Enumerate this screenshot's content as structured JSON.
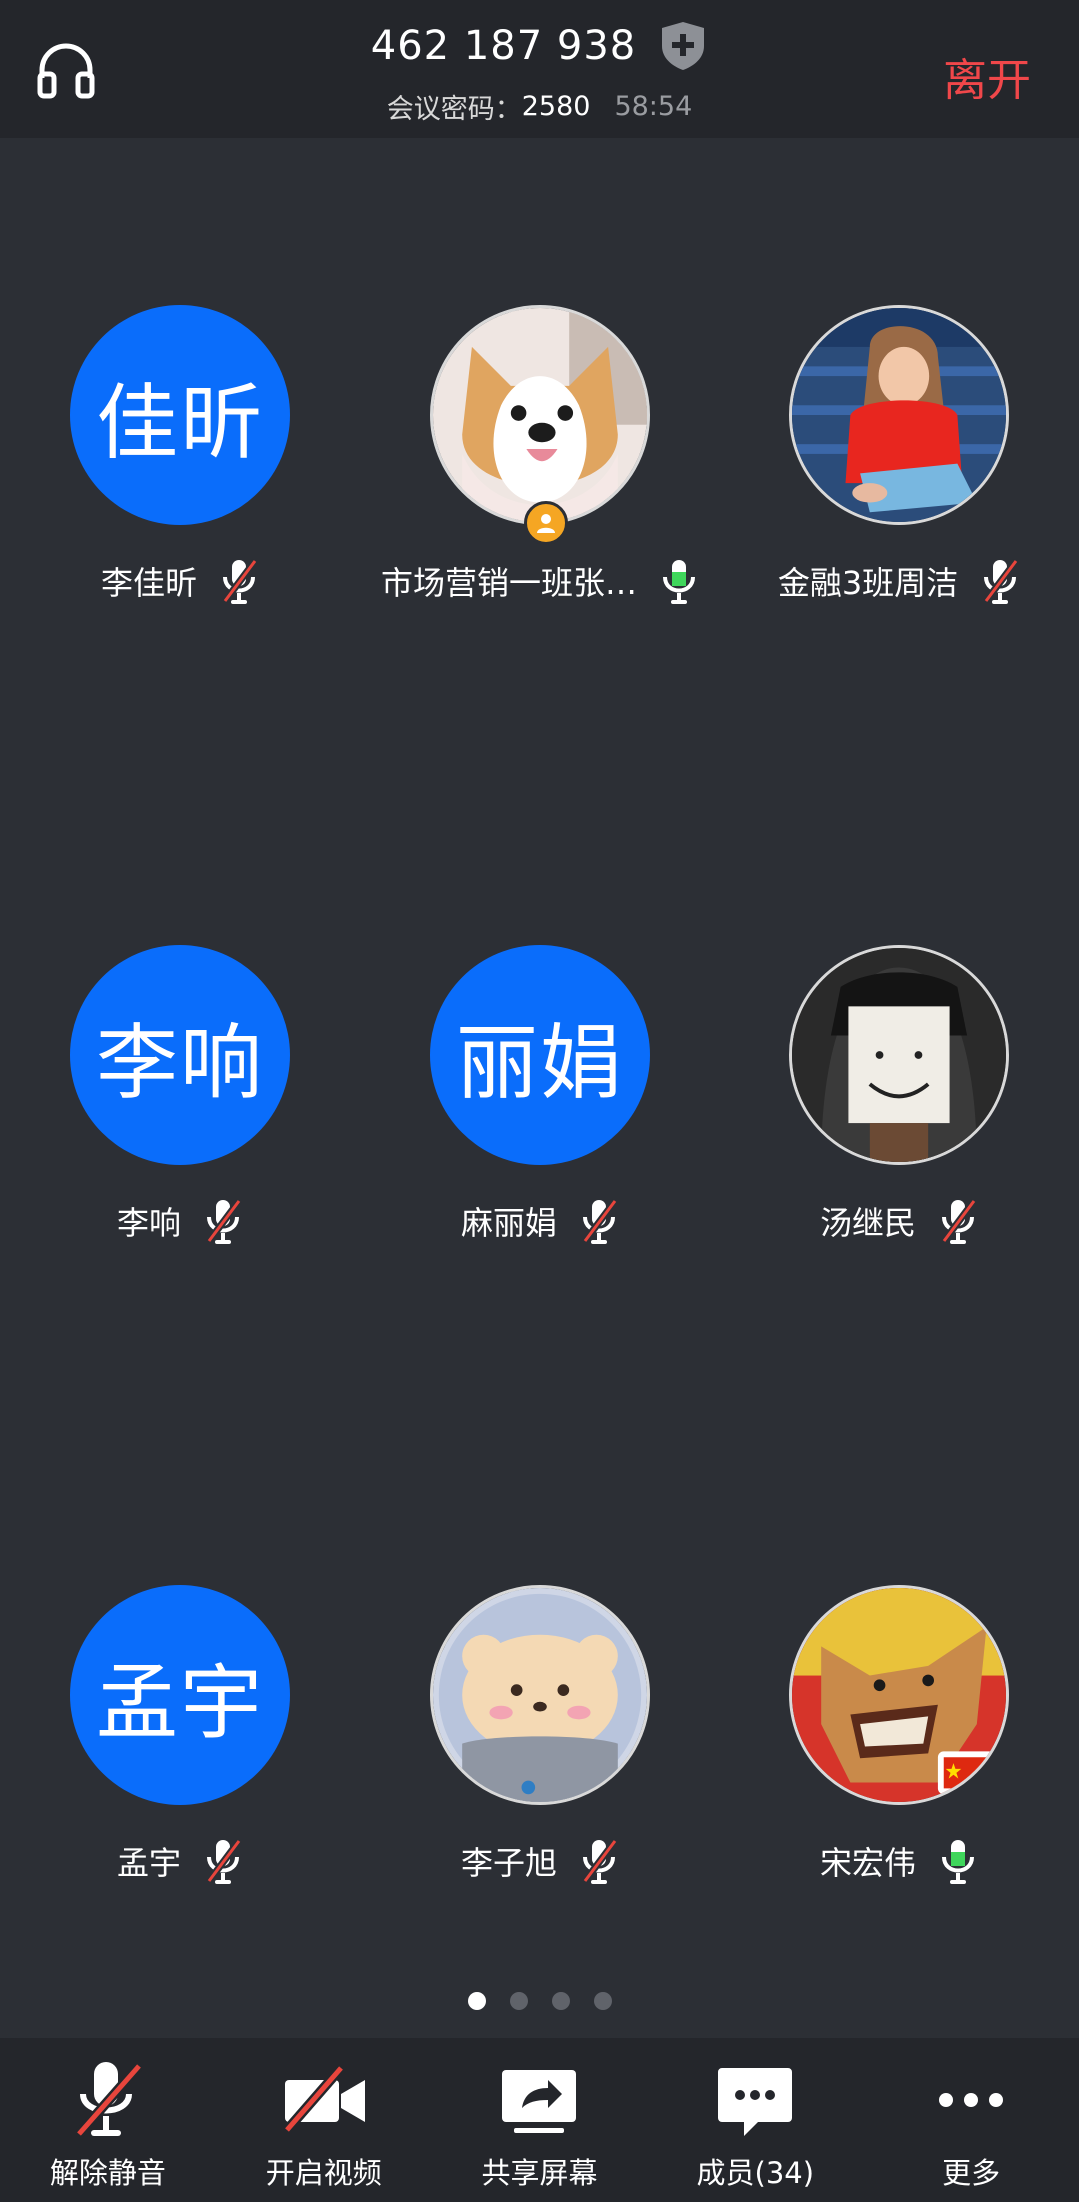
{
  "header": {
    "meeting_id": "462 187 938",
    "password_label": "会议密码：",
    "password_value": "2580",
    "timer": "58:54",
    "leave_label": "离开",
    "audio_icon": "headset-icon",
    "security_icon": "shield-plus-icon"
  },
  "participants": [
    {
      "name": "李佳昕",
      "avatar_text": "佳昕",
      "mic": "muted"
    },
    {
      "name": "市场营销一班张…",
      "avatar_image": "corgi-dog-photo",
      "mic": "active",
      "host": true
    },
    {
      "name": "金融3班周洁",
      "avatar_image": "girl-in-red-photo",
      "mic": "muted"
    },
    {
      "name": "李响",
      "avatar_text": "李响",
      "mic": "muted"
    },
    {
      "name": "麻丽娟",
      "avatar_text": "丽娟",
      "mic": "muted"
    },
    {
      "name": "汤继民",
      "avatar_image": "paper-face-photo",
      "mic": "muted"
    },
    {
      "name": "孟宇",
      "avatar_text": "孟宇",
      "mic": "muted"
    },
    {
      "name": "李子旭",
      "avatar_image": "bear-cartoon-photo",
      "mic": "muted"
    },
    {
      "name": "宋宏伟",
      "avatar_image": "wolf-photo",
      "mic": "active"
    }
  ],
  "pagination": {
    "pages": 4,
    "current": 1
  },
  "toolbar": {
    "unmute_label": "解除静音",
    "video_label": "开启视频",
    "share_label": "共享屏幕",
    "members_label": "成员(34)",
    "more_label": "更多"
  },
  "colors": {
    "background": "#2c2f35",
    "bar": "#24262b",
    "avatar_blue": "#0a6dfb",
    "leave_red": "#f0474a",
    "mic_green": "#3fd65b",
    "mute_red": "#e8453c",
    "host_orange": "#f5a623"
  }
}
